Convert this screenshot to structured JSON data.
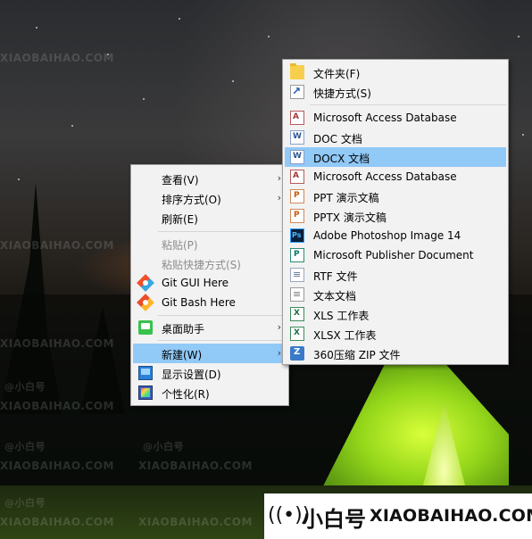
{
  "desktop": {
    "watermark_text": "@小白号",
    "watermark_url": "XIAOBAIHAO.COM"
  },
  "context_menu": {
    "items": [
      {
        "label": "查看(V)",
        "icon": "view-icon"
      },
      {
        "label": "排序方式(O)",
        "icon": "sort-icon"
      },
      {
        "label": "刷新(E)",
        "icon": "refresh-icon"
      },
      {
        "label": "粘贴(P)",
        "icon": "paste-icon"
      },
      {
        "label": "粘贴快捷方式(S)",
        "icon": "paste-shortcut-icon"
      },
      {
        "label": "Git GUI Here",
        "icon": "git-gui-icon"
      },
      {
        "label": "Git Bash Here",
        "icon": "git-bash-icon"
      },
      {
        "label": "桌面助手",
        "icon": "desktop-helper-icon"
      },
      {
        "label": "新建(W)",
        "icon": "new-icon"
      },
      {
        "label": "显示设置(D)",
        "icon": "display-settings-icon"
      },
      {
        "label": "个性化(R)",
        "icon": "personalize-icon"
      }
    ]
  },
  "submenu": {
    "items": [
      {
        "label": "文件夹(F)",
        "icon": "folder-icon"
      },
      {
        "label": "快捷方式(S)",
        "icon": "shortcut-icon"
      },
      {
        "label": "Microsoft Access Database",
        "icon": "access-icon"
      },
      {
        "label": "DOC 文档",
        "icon": "doc-icon"
      },
      {
        "label": "DOCX 文档",
        "icon": "docx-icon"
      },
      {
        "label": "Microsoft Access Database",
        "icon": "access-icon"
      },
      {
        "label": "PPT 演示文稿",
        "icon": "ppt-icon"
      },
      {
        "label": "PPTX 演示文稿",
        "icon": "pptx-icon"
      },
      {
        "label": "Adobe Photoshop Image 14",
        "icon": "photoshop-icon"
      },
      {
        "label": "Microsoft Publisher Document",
        "icon": "publisher-icon"
      },
      {
        "label": "RTF 文件",
        "icon": "rtf-icon"
      },
      {
        "label": "文本文档",
        "icon": "text-doc-icon"
      },
      {
        "label": "XLS 工作表",
        "icon": "xls-icon"
      },
      {
        "label": "XLSX 工作表",
        "icon": "xlsx-icon"
      },
      {
        "label": "360压缩 ZIP 文件",
        "icon": "zip-icon"
      }
    ],
    "highlight_color": "#91c9f7"
  },
  "brand": {
    "name": "小白号",
    "url": "XIAOBAIHAO.COM"
  }
}
